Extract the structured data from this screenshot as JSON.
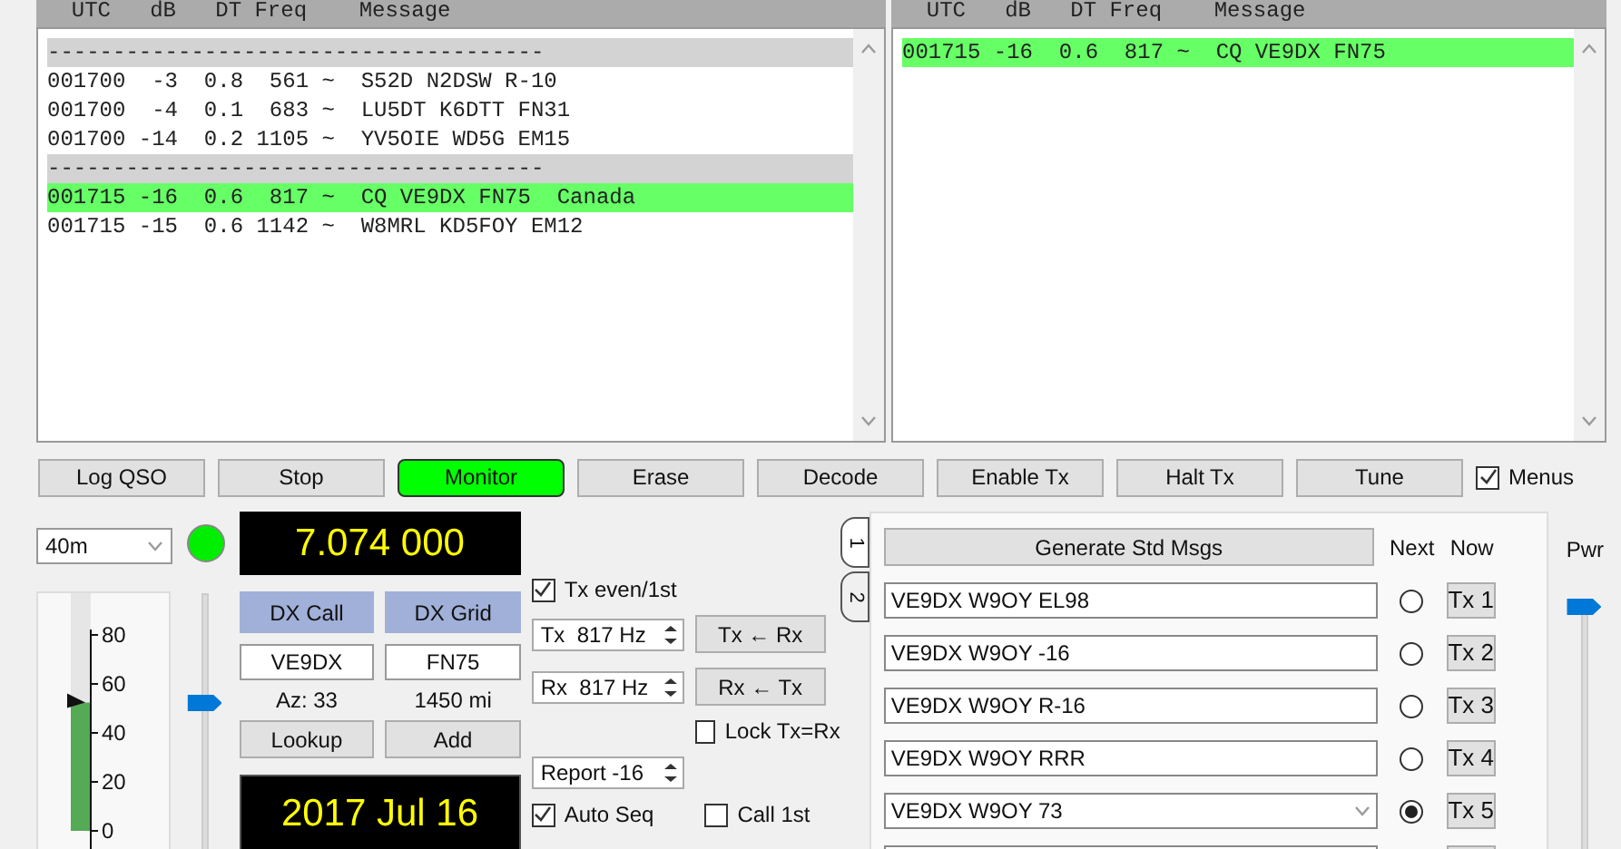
{
  "decode_panels": [
    {
      "header": "  UTC   dB   DT Freq    Message",
      "rows": [
        {
          "kind": "separator",
          "text": "--------------------------------------",
          "highlighted": false
        },
        {
          "kind": "decode",
          "text": "001700  -3  0.8  561 ~  S52D N2DSW R-10",
          "highlighted": false
        },
        {
          "kind": "decode",
          "text": "001700  -4  0.1  683 ~  LU5DT K6DTT FN31",
          "highlighted": false
        },
        {
          "kind": "decode",
          "text": "001700 -14  0.2 1105 ~  YV5OIE WD5G EM15",
          "highlighted": false
        },
        {
          "kind": "separator",
          "text": "--------------------------------------",
          "highlighted": false
        },
        {
          "kind": "decode",
          "text": "001715 -16  0.6  817 ~  CQ VE9DX FN75  Canada",
          "highlighted": true
        },
        {
          "kind": "decode",
          "text": "001715 -15  0.6 1142 ~  W8MRL KD5FOY EM12",
          "highlighted": false
        }
      ]
    },
    {
      "header": "  UTC   dB   DT Freq    Message",
      "rows": [
        {
          "kind": "decode",
          "text": "001715 -16  0.6  817 ~  CQ VE9DX FN75",
          "highlighted": true
        }
      ]
    }
  ],
  "buttons": [
    {
      "label": "Log QSO",
      "active": false
    },
    {
      "label": "Stop",
      "active": false
    },
    {
      "label": "Monitor",
      "active": true
    },
    {
      "label": "Erase",
      "active": false
    },
    {
      "label": "Decode",
      "active": false
    },
    {
      "label": "Enable Tx",
      "active": false
    },
    {
      "label": "Halt Tx",
      "active": false
    },
    {
      "label": "Tune",
      "active": false
    }
  ],
  "menus": {
    "label": "Menus",
    "checked": true
  },
  "band": {
    "value": "40m"
  },
  "status_led": {
    "on": true
  },
  "dial_frequency": "7.074 000",
  "meter": {
    "level": 0.54,
    "ticks": [
      "80",
      "60",
      "40",
      "20",
      "0"
    ]
  },
  "rx_slider": {
    "level": 0.6
  },
  "dx": {
    "call_label": "DX Call",
    "grid_label": "DX Grid",
    "call": "VE9DX",
    "grid": "FN75",
    "azimuth": "Az: 33",
    "distance": "1450 mi",
    "lookup": "Lookup",
    "add": "Add"
  },
  "date": "2017 Jul 16",
  "tx_even": {
    "label": "Tx even/1st",
    "checked": true
  },
  "tx_freq": {
    "value": "Tx  817 Hz",
    "button": "Tx ← Rx"
  },
  "rx_freq": {
    "value": "Rx  817 Hz",
    "button": "Rx ← Tx"
  },
  "lock": {
    "label": "Lock Tx=Rx",
    "checked": false
  },
  "report": {
    "value": "Report -16"
  },
  "auto_seq": {
    "label": "Auto Seq",
    "checked": true
  },
  "call_1st": {
    "label": "Call 1st",
    "checked": false
  },
  "tabs": [
    {
      "label": "1",
      "selected": true
    },
    {
      "label": "2",
      "selected": false
    }
  ],
  "generate": "Generate Std Msgs",
  "next_header": "Next",
  "now_header": "Now",
  "messages": [
    {
      "kind": "field",
      "text": "VE9DX W9OY EL98",
      "selected": false,
      "button": "Tx 1"
    },
    {
      "kind": "field",
      "text": "VE9DX W9OY -16",
      "selected": false,
      "button": "Tx 2"
    },
    {
      "kind": "field",
      "text": "VE9DX W9OY R-16",
      "selected": false,
      "button": "Tx 3"
    },
    {
      "kind": "field",
      "text": "VE9DX W9OY RRR",
      "selected": false,
      "button": "Tx 4"
    },
    {
      "kind": "dropdown",
      "text": "VE9DX W9OY 73",
      "selected": true,
      "button": "Tx 5"
    },
    {
      "kind": "field"
    }
  ],
  "power": {
    "label": "Pwr",
    "level": 1
  }
}
